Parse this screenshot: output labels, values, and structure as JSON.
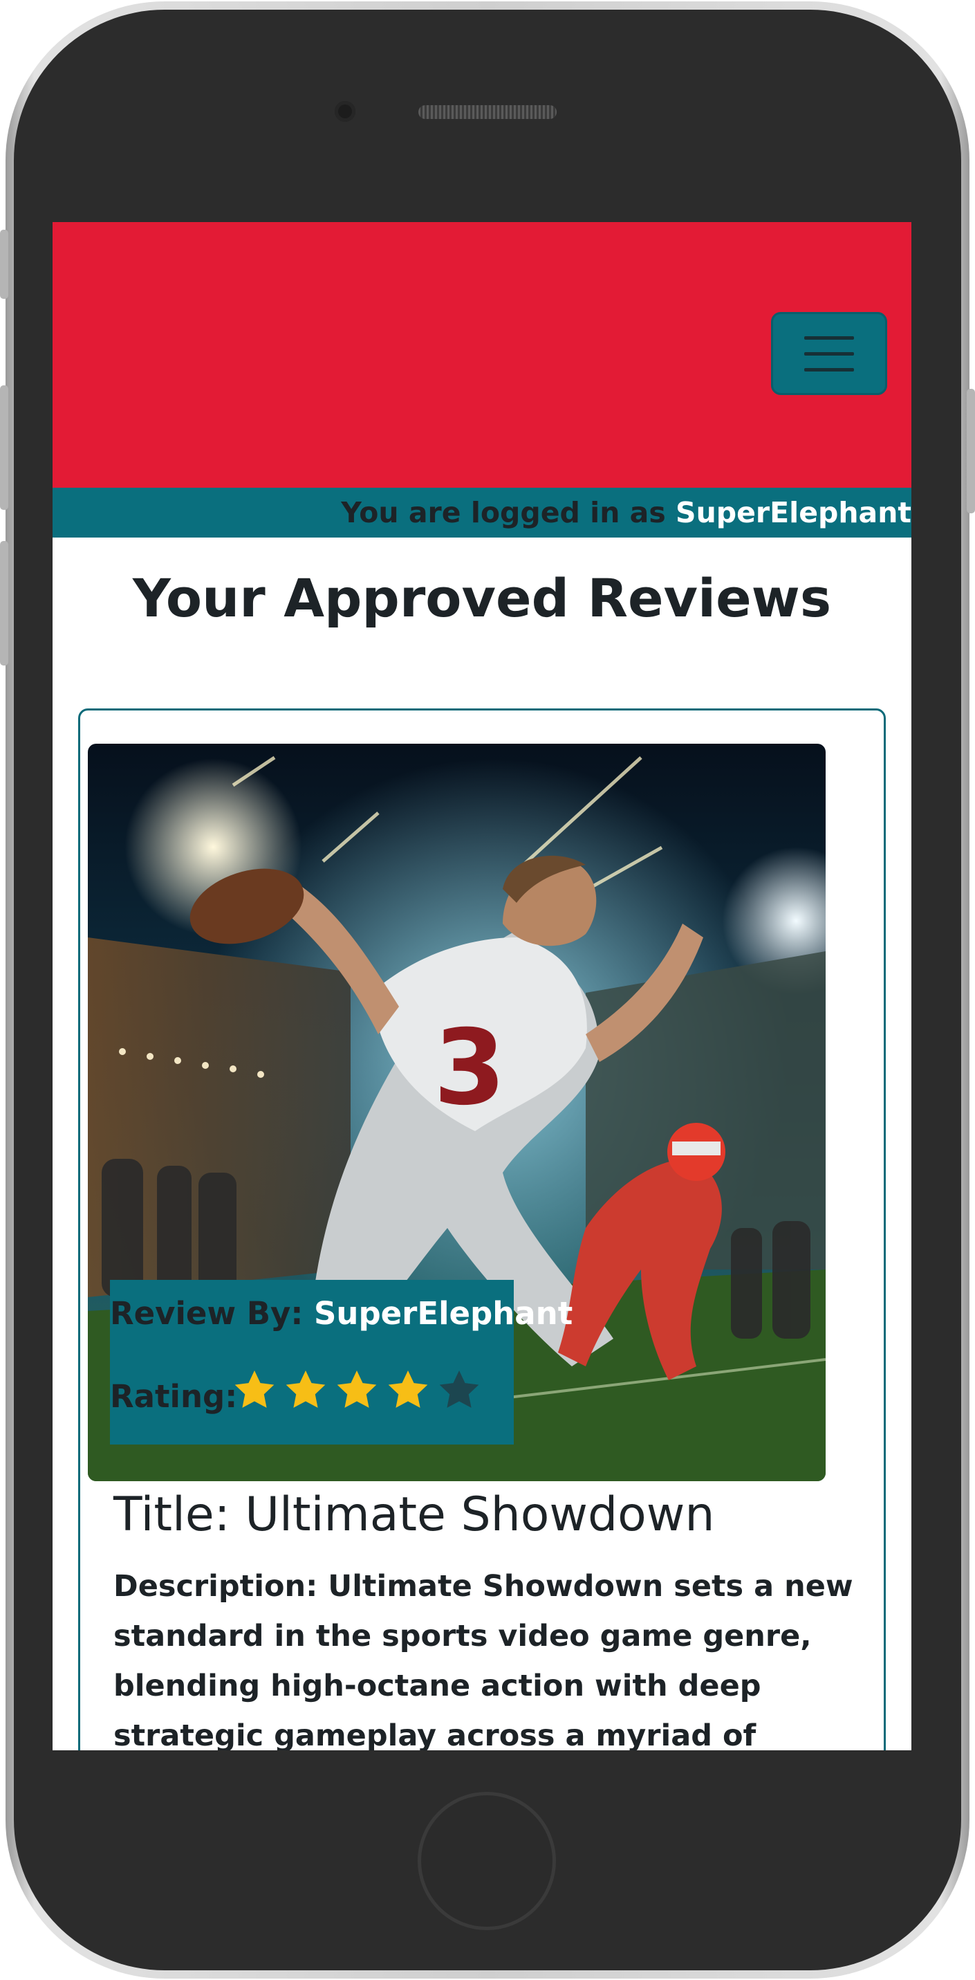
{
  "colors": {
    "header_red": "#e31b35",
    "teal": "#0a6f7e",
    "text_dark": "#1d2327",
    "star_gold": "#f7be16",
    "star_empty": "#1c4650"
  },
  "header": {
    "menu_icon": "hamburger-icon"
  },
  "login": {
    "prefix": "You are logged in as",
    "username": "SuperElephant"
  },
  "page": {
    "title": "Your Approved Reviews"
  },
  "review": {
    "by_label": "Review By:",
    "by_value": "SuperElephant",
    "rating_label": "Rating:",
    "rating": 4,
    "rating_max": 5,
    "title": "Title: Ultimate Showdown",
    "description": "Description: Ultimate Showdown sets a new standard in the sports video game genre, blending high-octane action with deep strategic gameplay across a myriad of sports in one"
  }
}
